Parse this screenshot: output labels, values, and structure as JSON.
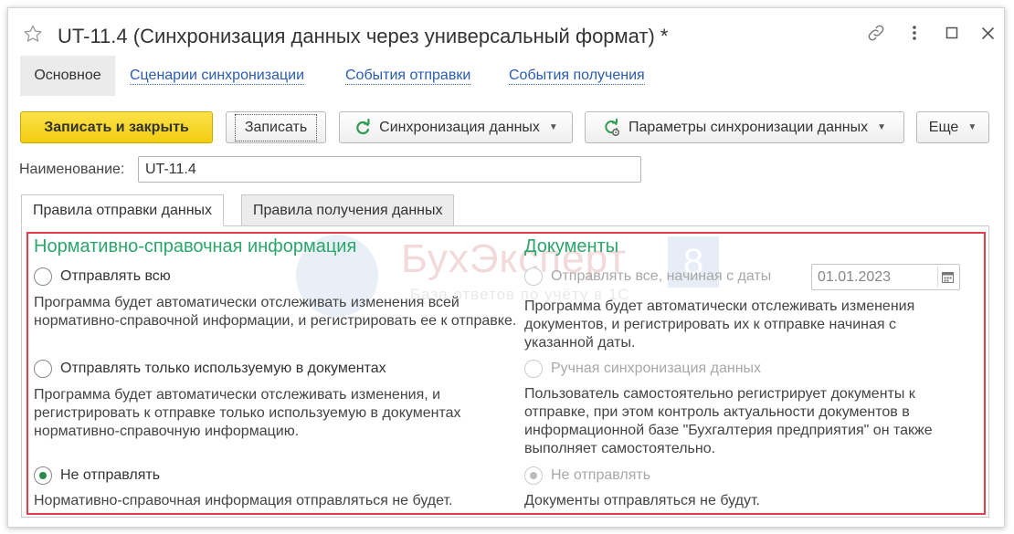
{
  "window": {
    "title": "UT-11.4 (Синхронизация данных через универсальный формат) *"
  },
  "nav": {
    "tabs": [
      "Основное",
      "Сценарии синхронизации",
      "События отправки",
      "События получения"
    ]
  },
  "toolbar": {
    "save_close": "Записать и закрыть",
    "save": "Записать",
    "sync": "Синхронизация данных",
    "sync_params": "Параметры синхронизации данных",
    "more": "Еще"
  },
  "name_field": {
    "label": "Наименование:",
    "value": "UT-11.4"
  },
  "tabs": {
    "send_rules": "Правила отправки данных",
    "receive_rules": "Правила получения данных"
  },
  "watermark": {
    "brand": "БухЭксперт",
    "number": "8",
    "tagline": "База ответов по учёту в 1С"
  },
  "nsi": {
    "heading": "Нормативно-справочная информация",
    "options": [
      {
        "label": "Отправлять всю",
        "selected": false,
        "description": "Программа будет автоматически отслеживать изменения всей нормативно-справочной информации, и регистрировать ее к отправке."
      },
      {
        "label": "Отправлять только используемую в документах",
        "selected": false,
        "description": "Программа будет автоматически отслеживать изменения, и регистрировать к отправке только используемую в документах нормативно-справочную информацию."
      },
      {
        "label": "Не отправлять",
        "selected": true,
        "description": "Нормативно-справочная информация отправляться не будет."
      }
    ]
  },
  "docs": {
    "heading": "Документы",
    "options": [
      {
        "label": "Отправлять все, начиная с даты",
        "selected": false,
        "disabled": true,
        "date": "01.01.2023",
        "description": "Программа будет автоматически отслеживать изменения документов, и регистрировать их к отправке начиная с указанной даты."
      },
      {
        "label": "Ручная синхронизация данных",
        "selected": false,
        "disabled": true,
        "description": "Пользователь самостоятельно регистрирует документы к отправке, при этом контроль актуальности документов в информационной базе \"Бухгалтерия предприятия\" он также выполняет самостоятельно."
      },
      {
        "label": "Не отправлять",
        "selected": true,
        "disabled": true,
        "description": "Документы отправляться не будут."
      }
    ]
  },
  "colors": {
    "accent_green": "#2ca66a",
    "link_blue": "#2a5cb0",
    "primary_yellow": "#f2cd0e",
    "highlight_red": "#e23d4a"
  }
}
